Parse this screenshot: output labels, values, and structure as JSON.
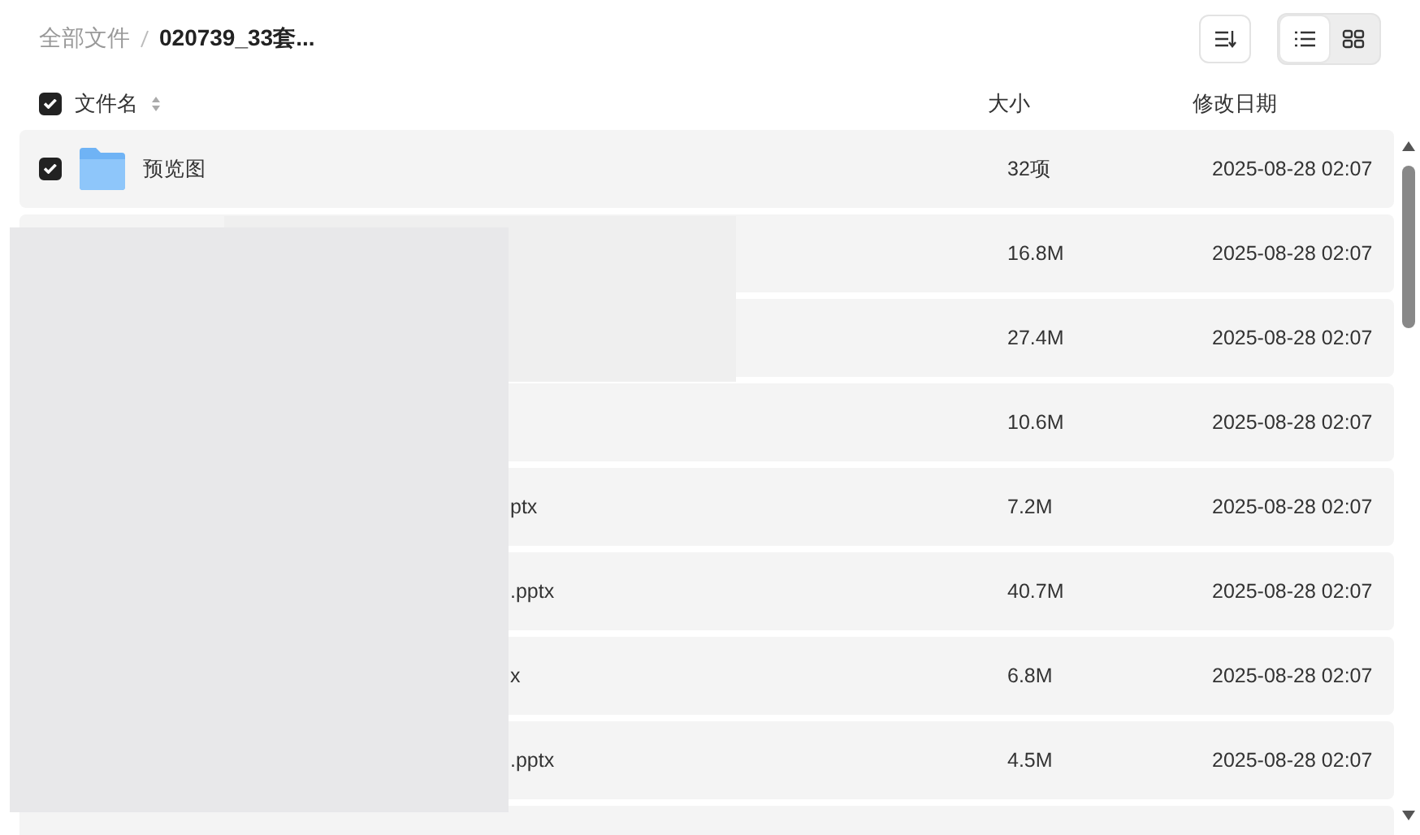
{
  "breadcrumb": [
    {
      "label": "全部文件",
      "current": false
    },
    {
      "label": "020739_33套...",
      "current": true
    }
  ],
  "toolbar": {
    "view_modes": [
      {
        "kind": "list",
        "selected": true
      },
      {
        "kind": "grid",
        "selected": false
      }
    ]
  },
  "table": {
    "select_all": {
      "checked": true
    },
    "columns": [
      "文件名",
      "大小",
      "修改日期"
    ],
    "rows": [
      {
        "kind": "folder",
        "checked": true,
        "name": "预览图",
        "size": "32项",
        "modified": "2025-08-28 02:07"
      },
      {
        "kind": "hidden",
        "size": "16.8M",
        "modified": "2025-08-28 02:07"
      },
      {
        "kind": "hidden",
        "size": "27.4M",
        "modified": "2025-08-28 02:07"
      },
      {
        "kind": "hidden",
        "size": "10.6M",
        "modified": "2025-08-28 02:07"
      },
      {
        "kind": "partial",
        "name": "ptx",
        "size": "7.2M",
        "modified": "2025-08-28 02:07"
      },
      {
        "kind": "partial",
        "name": ".pptx",
        "size": "40.7M",
        "modified": "2025-08-28 02:07"
      },
      {
        "kind": "partial",
        "name": "x",
        "size": "6.8M",
        "modified": "2025-08-28 02:07"
      },
      {
        "kind": "partial",
        "name": ".pptx",
        "size": "4.5M",
        "modified": "2025-08-28 02:07"
      }
    ]
  }
}
